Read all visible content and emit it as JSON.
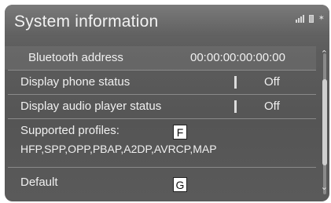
{
  "header": {
    "title": "System information"
  },
  "rows": {
    "bluetooth": {
      "label": "Bluetooth address",
      "value": "00:00:00:00:00:00"
    },
    "phone": {
      "label": "Display phone status",
      "value": "Off"
    },
    "audio": {
      "label": "Display audio player status",
      "value": "Off"
    },
    "profiles": {
      "label": "Supported profiles:",
      "value": "HFP,SPP,OPP,PBAP,A2DP,AVRCP,MAP"
    },
    "default": {
      "label": "Default"
    }
  },
  "markers": {
    "f": "F",
    "g": "G"
  },
  "icons": {
    "signal": "signal-bars-icon",
    "battery": "battery-icon",
    "bluetooth": "bluetooth-icon",
    "scroll_up": "chevron-up-icon",
    "scroll_down": "chevron-down-icon"
  }
}
